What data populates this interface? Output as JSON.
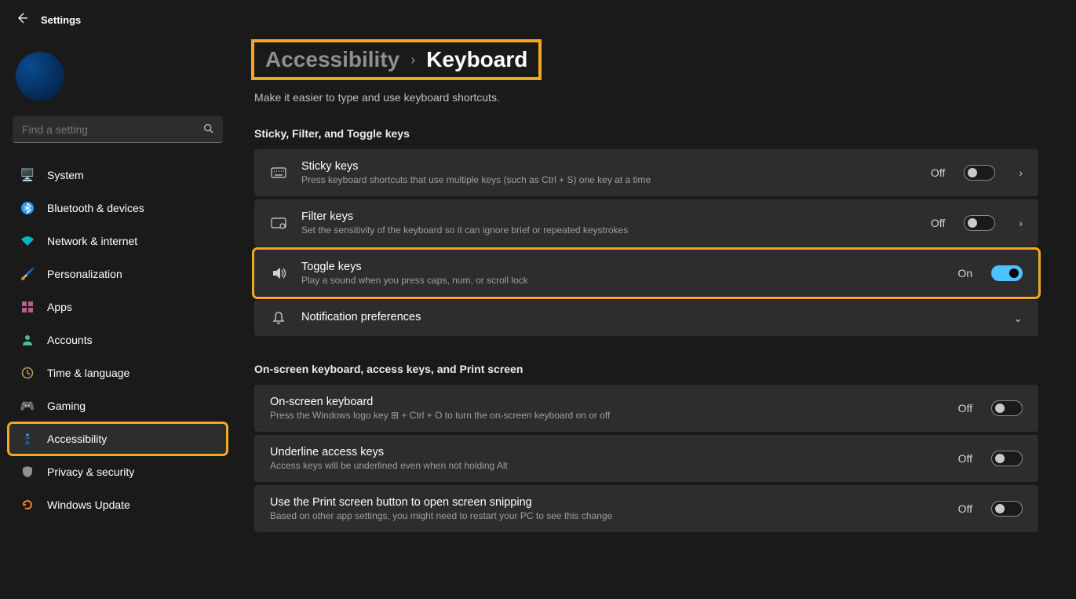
{
  "app_title": "Settings",
  "search_placeholder": "Find a setting",
  "sidebar": {
    "items": [
      {
        "label": "System"
      },
      {
        "label": "Bluetooth & devices"
      },
      {
        "label": "Network & internet"
      },
      {
        "label": "Personalization"
      },
      {
        "label": "Apps"
      },
      {
        "label": "Accounts"
      },
      {
        "label": "Time & language"
      },
      {
        "label": "Gaming"
      },
      {
        "label": "Accessibility"
      },
      {
        "label": "Privacy & security"
      },
      {
        "label": "Windows Update"
      }
    ]
  },
  "breadcrumb": {
    "parent": "Accessibility",
    "current": "Keyboard"
  },
  "page_desc": "Make it easier to type and use keyboard shortcuts.",
  "section1_head": "Sticky, Filter, and Toggle keys",
  "section2_head": "On-screen keyboard, access keys, and Print screen",
  "rows": {
    "sticky": {
      "title": "Sticky keys",
      "desc": "Press keyboard shortcuts that use multiple keys (such as Ctrl + S) one key at a time",
      "state": "Off"
    },
    "filter": {
      "title": "Filter keys",
      "desc": "Set the sensitivity of the keyboard so it can ignore brief or repeated keystrokes",
      "state": "Off"
    },
    "toggle": {
      "title": "Toggle keys",
      "desc": "Play a sound when you press caps, num, or scroll lock",
      "state": "On"
    },
    "notify": {
      "title": "Notification preferences"
    },
    "osk": {
      "title": "On-screen keyboard",
      "desc": "Press the Windows logo key ⊞ + Ctrl + O to turn the on-screen keyboard on or off",
      "state": "Off"
    },
    "underline": {
      "title": "Underline access keys",
      "desc": "Access keys will be underlined even when not holding Alt",
      "state": "Off"
    },
    "printscreen": {
      "title": "Use the Print screen button to open screen snipping",
      "desc": "Based on other app settings, you might need to restart your PC to see this change",
      "state": "Off"
    }
  }
}
